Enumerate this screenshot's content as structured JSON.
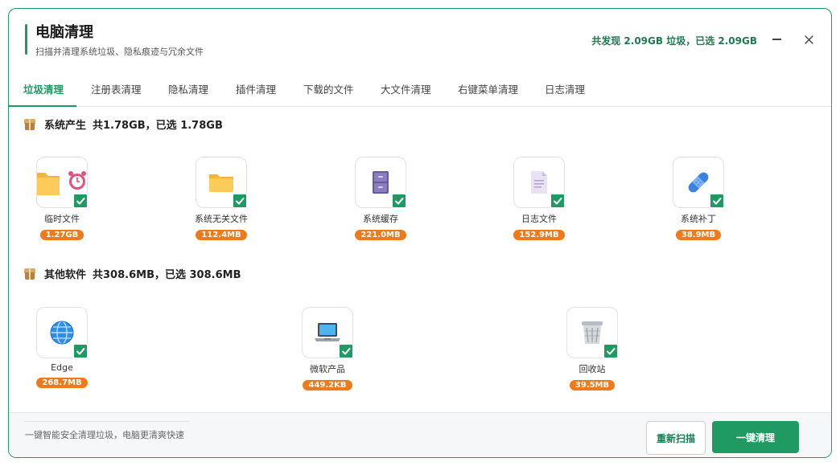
{
  "header": {
    "title": "电脑清理",
    "subtitle": "扫描并清理系统垃圾、隐私痕迹与冗余文件",
    "summary": "共发现 2.09GB 垃圾，已选 2.09GB"
  },
  "tabs": [
    {
      "label": "垃圾清理",
      "active": true
    },
    {
      "label": "注册表清理"
    },
    {
      "label": "隐私清理"
    },
    {
      "label": "插件清理"
    },
    {
      "label": "下载的文件"
    },
    {
      "label": "大文件清理"
    },
    {
      "label": "右键菜单清理"
    },
    {
      "label": "日志清理"
    }
  ],
  "sections": [
    {
      "name": "系统产生",
      "total": "共1.78GB，已选 1.78GB",
      "items": [
        {
          "label": "临时文件",
          "size": "1.27GB",
          "icon": "folder-alarm-icon"
        },
        {
          "label": "系统无关文件",
          "size": "112.4MB",
          "icon": "folder-icon"
        },
        {
          "label": "系统缓存",
          "size": "221.0MB",
          "icon": "file-cabinet-icon"
        },
        {
          "label": "日志文件",
          "size": "152.9MB",
          "icon": "document-icon"
        },
        {
          "label": "系统补丁",
          "size": "38.9MB",
          "icon": "bandage-icon"
        }
      ]
    },
    {
      "name": "其他软件",
      "total": "共308.6MB，已选 308.6MB",
      "items": [
        {
          "label": "Edge",
          "size": "268.7MB",
          "icon": "globe-icon"
        },
        {
          "label": "微软产品",
          "size": "449.2KB",
          "icon": "laptop-icon"
        },
        {
          "label": "回收站",
          "size": "39.5MB",
          "icon": "trash-bin-icon"
        }
      ]
    }
  ],
  "footer": {
    "hint": "一键智能安全清理垃圾，电脑更清爽快速",
    "rescan_label": "重新扫描",
    "clean_label": "一键清理"
  },
  "colors": {
    "accent": "#1f9a63",
    "badge": "#ef7a1c"
  }
}
